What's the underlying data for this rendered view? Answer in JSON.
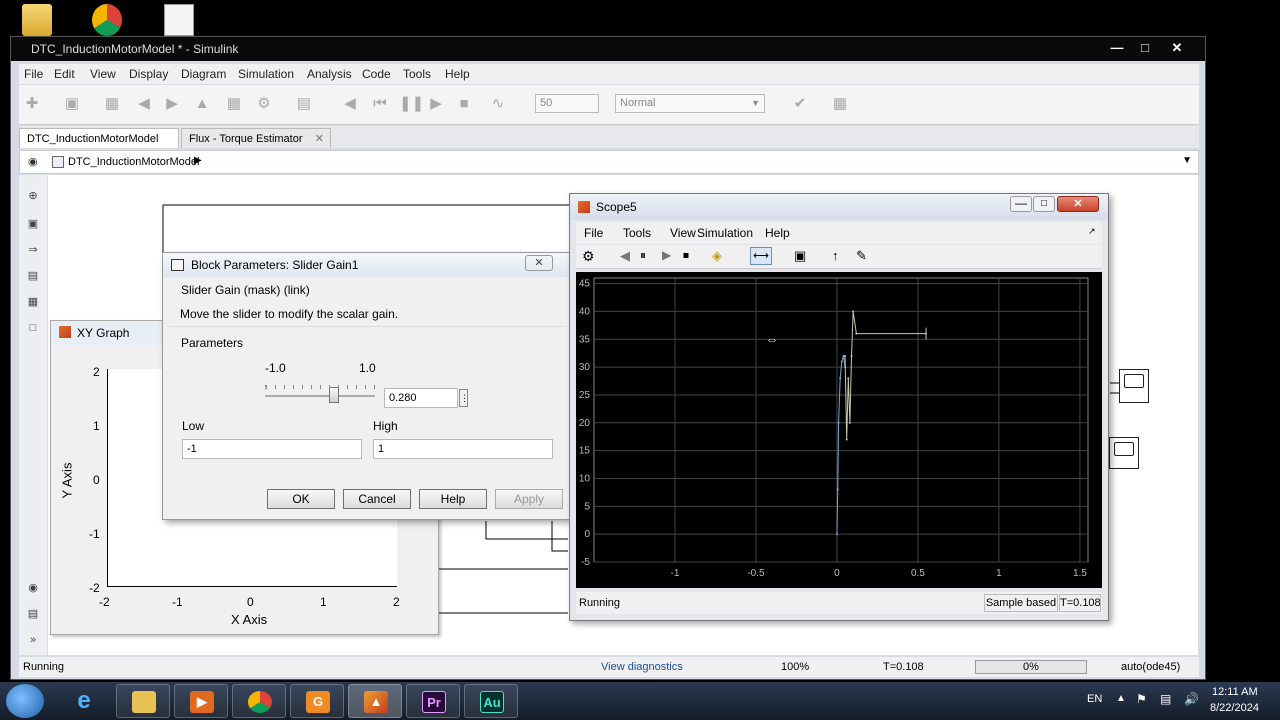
{
  "main_window": {
    "title": "DTC_InductionMotorModel * - Simulink",
    "menu": [
      "File",
      "Edit",
      "View",
      "Display",
      "Diagram",
      "Simulation",
      "Analysis",
      "Code",
      "Tools",
      "Help"
    ],
    "stop_time": "50",
    "sim_mode": "Normal",
    "tabs": [
      {
        "label": "DTC_InductionMotorModel"
      },
      {
        "label": "Flux - Torque Estimator"
      }
    ],
    "breadcrumb": "DTC_InductionMotorModel",
    "status": {
      "state": "Running",
      "diagnostics": "View diagnostics",
      "zoom": "100%",
      "time": "T=0.108",
      "progress": "0%",
      "solver": "auto(ode45)"
    }
  },
  "xy_graph": {
    "title": "XY Graph",
    "xlabel": "X Axis",
    "ylabel": "Y Axis",
    "xticks": [
      "-2",
      "-1",
      "0",
      "1",
      "2"
    ],
    "yticks": [
      "2",
      "1",
      "0",
      "-1",
      "-2"
    ]
  },
  "block_params": {
    "title": "Block Parameters: Slider Gain1",
    "mask_header": "Slider Gain (mask) (link)",
    "description": "Move the slider to modify the scalar gain.",
    "parameters_label": "Parameters",
    "slider_min_label": "-1.0",
    "slider_max_label": "1.0",
    "slider_value": "0.280",
    "slider_fraction": 0.64,
    "low_label": "Low",
    "low_value": "-1",
    "high_label": "High",
    "high_value": "1",
    "buttons": {
      "ok": "OK",
      "cancel": "Cancel",
      "help": "Help",
      "apply": "Apply"
    }
  },
  "scope": {
    "title": "Scope5",
    "menu": [
      "File",
      "Tools",
      "View",
      "Simulation",
      "Help"
    ],
    "yticks": [
      "45",
      "40",
      "35",
      "30",
      "25",
      "20",
      "15",
      "10",
      "5",
      "0",
      "-5"
    ],
    "xticks": [
      "-1",
      "-0.5",
      "0",
      "0.5",
      "1",
      "1.5"
    ],
    "status": "Running",
    "sample_mode": "Sample based",
    "time": "T=0.108"
  },
  "chart_data": {
    "type": "line",
    "xlim": [
      -1.5,
      1.55
    ],
    "ylim": [
      -5,
      46
    ],
    "grid": true,
    "series": [
      {
        "color": "#6fa8dc",
        "x": [
          0.0,
          0.005,
          0.01,
          0.02,
          0.03,
          0.04,
          0.05
        ],
        "y": [
          0,
          8,
          20,
          28,
          31,
          32,
          30
        ]
      },
      {
        "color": "#c8c8b0",
        "x": [
          0.05,
          0.06,
          0.07,
          0.08,
          0.09,
          0.1,
          0.12,
          0.55
        ],
        "y": [
          32,
          17,
          28,
          20,
          32,
          40,
          36,
          36
        ]
      }
    ]
  },
  "taskbar": {
    "language": "EN",
    "clock_time": "12:11 AM",
    "clock_date": "8/22/2024"
  },
  "colors": {
    "scope_bg": "#000000",
    "scope_grid": "#444444",
    "title_dark": "#0a0a0a",
    "taskbar": "#1c2a40"
  }
}
